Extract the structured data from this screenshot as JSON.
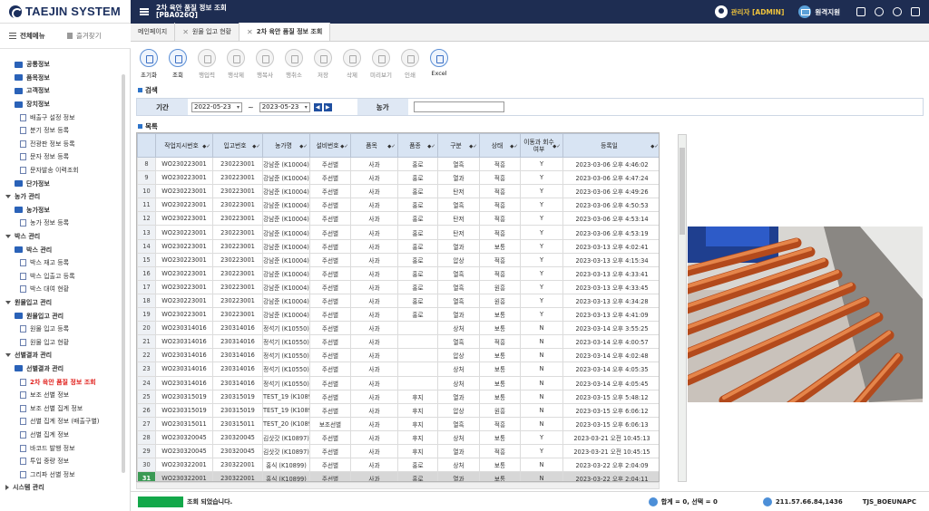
{
  "brand": {
    "name": "TAEJIN SYSTEM"
  },
  "topbar": {
    "title_line1": "2차 육안 품질 정보 조회",
    "title_line2": "[PBA026Q]",
    "user": "관리자 [ADMIN]",
    "remote": "원격지원"
  },
  "sidebar": {
    "all_menu": "전체메뉴",
    "favorites": "즐겨찾기",
    "items": [
      {
        "label": "공통정보",
        "level": 1,
        "kind": "folder"
      },
      {
        "label": "품목정보",
        "level": 1,
        "kind": "folder"
      },
      {
        "label": "고객정보",
        "level": 1,
        "kind": "folder"
      },
      {
        "label": "장치정보",
        "level": 1,
        "kind": "folder"
      },
      {
        "label": "배출구 설정 정보",
        "level": 2,
        "kind": "doc"
      },
      {
        "label": "분기 정보 등록",
        "level": 2,
        "kind": "doc"
      },
      {
        "label": "전광판 정보 등록",
        "level": 2,
        "kind": "doc"
      },
      {
        "label": "문자 정보 등록",
        "level": 2,
        "kind": "doc"
      },
      {
        "label": "문자발송 이력조회",
        "level": 2,
        "kind": "doc"
      },
      {
        "label": "단가정보",
        "level": 1,
        "kind": "folder"
      },
      {
        "label": "농가 관리",
        "level": 0,
        "kind": "group"
      },
      {
        "label": "농가정보",
        "level": 1,
        "kind": "folder"
      },
      {
        "label": "농가 정보 등록",
        "level": 2,
        "kind": "doc"
      },
      {
        "label": "박스 관리",
        "level": 0,
        "kind": "group"
      },
      {
        "label": "박스 관리",
        "level": 1,
        "kind": "folder"
      },
      {
        "label": "박스 재고 등록",
        "level": 2,
        "kind": "doc"
      },
      {
        "label": "박스 입출고 등록",
        "level": 2,
        "kind": "doc"
      },
      {
        "label": "박스 대여 현황",
        "level": 2,
        "kind": "doc"
      },
      {
        "label": "원물입고 관리",
        "level": 0,
        "kind": "group"
      },
      {
        "label": "원물입고 관리",
        "level": 1,
        "kind": "folder"
      },
      {
        "label": "원물 입고 등록",
        "level": 2,
        "kind": "doc"
      },
      {
        "label": "원물 입고 현황",
        "level": 2,
        "kind": "doc"
      },
      {
        "label": "선별결과 관리",
        "level": 0,
        "kind": "group"
      },
      {
        "label": "선별결과 관리",
        "level": 1,
        "kind": "folder"
      },
      {
        "label": "2차 육안 품질 정보 조회",
        "level": 2,
        "kind": "doc",
        "active": true
      },
      {
        "label": "보조 선별 정보",
        "level": 2,
        "kind": "doc"
      },
      {
        "label": "보조 선별 집계 정보",
        "level": 2,
        "kind": "doc"
      },
      {
        "label": "선별 집계 정보 (배출구별)",
        "level": 2,
        "kind": "doc"
      },
      {
        "label": "선별 집계 정보",
        "level": 2,
        "kind": "doc"
      },
      {
        "label": "바코드 발행 정보",
        "level": 2,
        "kind": "doc"
      },
      {
        "label": "투입 중량 정보",
        "level": 2,
        "kind": "doc"
      },
      {
        "label": "그리파 선별 정보",
        "level": 2,
        "kind": "doc"
      },
      {
        "label": "시스템 관리",
        "level": 0,
        "kind": "group-closed"
      }
    ]
  },
  "tabs": [
    {
      "label": "메인페이지",
      "closable": false,
      "active": false
    },
    {
      "label": "원물 입고 현황",
      "closable": true,
      "active": false
    },
    {
      "label": "2차 육안 품질 정보 조회",
      "closable": true,
      "active": true
    }
  ],
  "toolbar": [
    {
      "label": "초기화",
      "enabled": true
    },
    {
      "label": "조회",
      "enabled": true
    },
    {
      "label": "행입력",
      "enabled": false
    },
    {
      "label": "행삭제",
      "enabled": false
    },
    {
      "label": "행복사",
      "enabled": false
    },
    {
      "label": "행취소",
      "enabled": false
    },
    {
      "label": "저장",
      "enabled": false
    },
    {
      "label": "삭제",
      "enabled": false
    },
    {
      "label": "미리보기",
      "enabled": false
    },
    {
      "label": "인쇄",
      "enabled": false
    },
    {
      "label": "Excel",
      "enabled": true
    }
  ],
  "search": {
    "section": "검색",
    "period_label": "기간",
    "date_from": "2022-05-23",
    "date_to": "2023-05-23",
    "tilde": "~",
    "farm_label": "농가",
    "farm_value": ""
  },
  "list": {
    "section": "목록",
    "columns": [
      "",
      "작업지시번호",
      "입고번호",
      "농가명",
      "설비번호",
      "품목",
      "품종",
      "구분",
      "상태",
      "이동과 회수여부",
      "등록일"
    ],
    "rows": [
      [
        "8",
        "WO230223001",
        "230223001",
        "강남준 (K10004)",
        "주선별",
        "사과",
        "홍로",
        "열흑",
        "적흥",
        "Y",
        "2023-03-06 오후 4:46:02"
      ],
      [
        "9",
        "WO230223001",
        "230223001",
        "강남준 (K10004)",
        "주선별",
        "사과",
        "홍로",
        "열과",
        "적흥",
        "Y",
        "2023-03-06 오후 4:47:24"
      ],
      [
        "10",
        "WO230223001",
        "230223001",
        "강남준 (K10004)",
        "주선별",
        "사과",
        "홍로",
        "탄저",
        "적흥",
        "Y",
        "2023-03-06 오후 4:49:26"
      ],
      [
        "11",
        "WO230223001",
        "230223001",
        "강남준 (K10004)",
        "주선별",
        "사과",
        "홍로",
        "열흑",
        "적흥",
        "Y",
        "2023-03-06 오후 4:50:53"
      ],
      [
        "12",
        "WO230223001",
        "230223001",
        "강남준 (K10004)",
        "주선별",
        "사과",
        "홍로",
        "탄저",
        "적흥",
        "Y",
        "2023-03-06 오후 4:53:14"
      ],
      [
        "13",
        "WO230223001",
        "230223001",
        "강남준 (K10004)",
        "주선별",
        "사과",
        "홍로",
        "탄저",
        "적흥",
        "Y",
        "2023-03-06 오후 4:53:19"
      ],
      [
        "14",
        "WO230223001",
        "230223001",
        "강남준 (K10004)",
        "주선별",
        "사과",
        "홍로",
        "열과",
        "보통",
        "Y",
        "2023-03-13 오후 4:02:41"
      ],
      [
        "15",
        "WO230223001",
        "230223001",
        "강남준 (K10004)",
        "주선별",
        "사과",
        "홍로",
        "압상",
        "적흥",
        "Y",
        "2023-03-13 오후 4:15:34"
      ],
      [
        "16",
        "WO230223001",
        "230223001",
        "강남준 (K10004)",
        "주선별",
        "사과",
        "홍로",
        "열흑",
        "적흥",
        "Y",
        "2023-03-13 오후 4:33:41"
      ],
      [
        "17",
        "WO230223001",
        "230223001",
        "강남준 (K10004)",
        "주선별",
        "사과",
        "홍로",
        "열흑",
        "원흥",
        "Y",
        "2023-03-13 오후 4:33:45"
      ],
      [
        "18",
        "WO230223001",
        "230223001",
        "강남준 (K10004)",
        "주선별",
        "사과",
        "홍로",
        "열흑",
        "원흥",
        "Y",
        "2023-03-13 오후 4:34:28"
      ],
      [
        "19",
        "WO230223001",
        "230223001",
        "강남준 (K10004)",
        "주선별",
        "사과",
        "홍로",
        "열과",
        "보통",
        "Y",
        "2023-03-13 오후 4:41:09"
      ],
      [
        "20",
        "WO230314016",
        "230314016",
        "정석기 (K10550)",
        "주선별",
        "사과",
        "",
        "상처",
        "보통",
        "N",
        "2023-03-14 오후 3:55:25"
      ],
      [
        "21",
        "WO230314016",
        "230314016",
        "정석기 (K10550)",
        "주선별",
        "사과",
        "",
        "열흑",
        "적흥",
        "N",
        "2023-03-14 오후 4:00:57"
      ],
      [
        "22",
        "WO230314016",
        "230314016",
        "정석기 (K10550)",
        "주선별",
        "사과",
        "",
        "압상",
        "보통",
        "N",
        "2023-03-14 오후 4:02:48"
      ],
      [
        "23",
        "WO230314016",
        "230314016",
        "정석기 (K10550)",
        "주선별",
        "사과",
        "",
        "상처",
        "보통",
        "N",
        "2023-03-14 오후 4:05:35"
      ],
      [
        "24",
        "WO230314016",
        "230314016",
        "정석기 (K10550)",
        "주선별",
        "사과",
        "",
        "상처",
        "보통",
        "N",
        "2023-03-14 오후 4:05:45"
      ],
      [
        "25",
        "WO230315019",
        "230315019",
        "TEST_19 (K10895)",
        "주선별",
        "사과",
        "후지",
        "열과",
        "보통",
        "N",
        "2023-03-15 오후 5:48:12"
      ],
      [
        "26",
        "WO230315019",
        "230315019",
        "TEST_19 (K10895)",
        "주선별",
        "사과",
        "후지",
        "압상",
        "원흥",
        "N",
        "2023-03-15 오후 6:06:12"
      ],
      [
        "27",
        "WO230315011",
        "230315011",
        "TEST_20 (K10896)",
        "보조선별",
        "사과",
        "후지",
        "열흑",
        "적흥",
        "N",
        "2023-03-15 오후 6:06:13"
      ],
      [
        "28",
        "WO230320045",
        "230320045",
        "김삿갓 (K10897)",
        "주선별",
        "사과",
        "후지",
        "상처",
        "보통",
        "Y",
        "2023-03-21 오전 10:45:13"
      ],
      [
        "29",
        "WO230320045",
        "230320045",
        "김삿갓 (K10897)",
        "주선별",
        "사과",
        "후지",
        "열과",
        "적흥",
        "Y",
        "2023-03-21 오전 10:45:15"
      ],
      [
        "30",
        "WO230322001",
        "230322001",
        "홍식 (K10899)",
        "주선별",
        "사과",
        "홍로",
        "상처",
        "보통",
        "N",
        "2023-03-22 오후 2:04:09"
      ],
      [
        "31",
        "WO230322001",
        "230322001",
        "홍식 (K10899)",
        "주선별",
        "사과",
        "홍로",
        "열과",
        "보통",
        "N",
        "2023-03-22 오후 2:04:11"
      ]
    ],
    "selected_row": "31"
  },
  "status": {
    "message": "조회 되었습니다.",
    "count": "합계 = 0, 선택 = 0",
    "ip": "211.57.66.84,1436",
    "host": "TJS_BOEUNAPC"
  },
  "colors": {
    "topbar": "#1e2d52",
    "accent": "#2c73c9",
    "selected": "#3b9a54",
    "status_ok": "#13a84a"
  }
}
